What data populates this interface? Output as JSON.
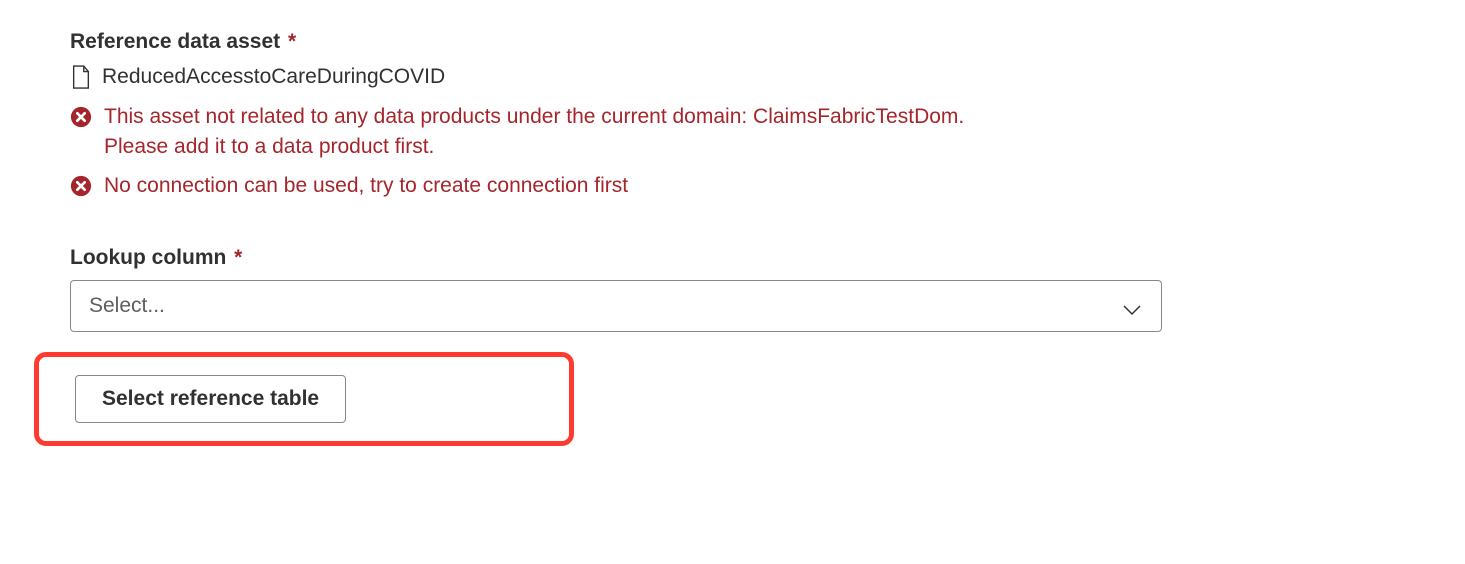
{
  "referenceDataAsset": {
    "label": "Reference data asset",
    "assetName": "ReducedAccesstoCareDuringCOVID",
    "errors": [
      "This asset not related to any data products under the current domain: ClaimsFabricTestDom. Please add it to a data product first.",
      "No connection can be used, try to create connection first"
    ]
  },
  "lookupColumn": {
    "label": "Lookup column",
    "placeholder": "Select..."
  },
  "selectReferenceTableButton": "Select reference table"
}
